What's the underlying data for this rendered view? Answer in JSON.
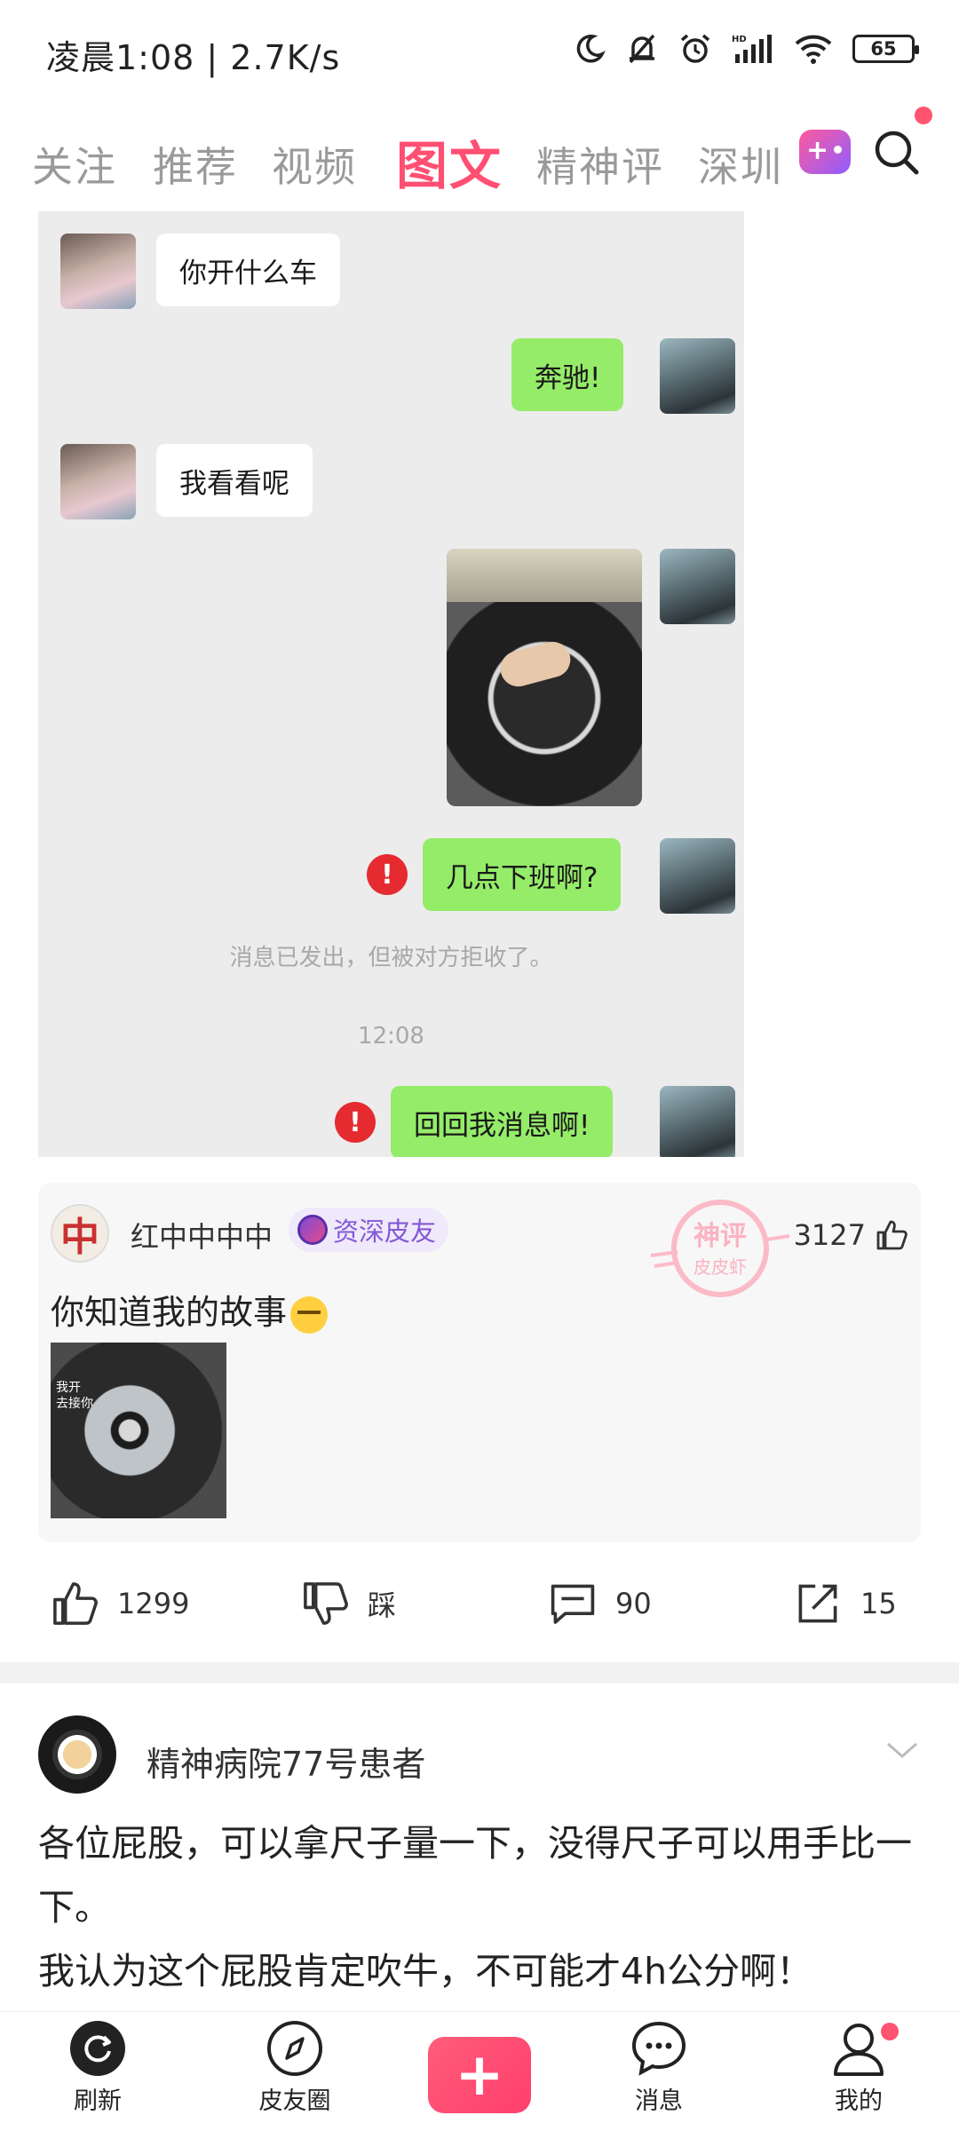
{
  "status_bar": {
    "time": "凌晨1:08 | 2.7K/s",
    "battery": "65",
    "icons": [
      "moon-icon",
      "mute-bell-icon",
      "alarm-icon",
      "hd-signal-icon",
      "wifi-icon",
      "battery-icon"
    ]
  },
  "tabs": {
    "items": [
      "关注",
      "推荐",
      "视频",
      "图文",
      "精神评",
      "深圳"
    ],
    "active": "图文",
    "game_icon": "game-icon",
    "search_icon": "search-icon"
  },
  "chat": {
    "messages": [
      {
        "side": "left",
        "text": "你开什么车"
      },
      {
        "side": "right",
        "text": "奔驰!"
      },
      {
        "side": "left",
        "text": "我看看呢"
      },
      {
        "side": "right",
        "type": "image",
        "text": ""
      },
      {
        "side": "right",
        "text": "几点下班啊?",
        "failed": true
      },
      {
        "side": "right",
        "text": "回回我消息啊!",
        "failed": true
      }
    ],
    "system_notice": "消息已发出，但被对方拒收了。",
    "timestamp": "12:08",
    "error_mark": "!"
  },
  "comment": {
    "avatar_char": "中",
    "username": "红中中中中",
    "badge": "资深皮友",
    "likes": "3127",
    "text": "你知道我的故事",
    "thumb_text_1": "我开",
    "thumb_text_2": "去接你",
    "watermark_1": "神评",
    "watermark_2": "皮皮虾"
  },
  "actions": {
    "like_count": "1299",
    "dislike_label": "踩",
    "comment_count": "90",
    "share_count": "15"
  },
  "next_post": {
    "username": "精神病院77号患者",
    "text_line1": "各位屁股，可以拿尺子量一下，没得尺子可以用手比一下。",
    "text_line2": "我认为这个屁股肯定吹牛，不可能才4h公分啊！"
  },
  "bottom_nav": {
    "refresh": "刷新",
    "circle": "皮友圈",
    "publish": "+",
    "messages": "消息",
    "me": "我的"
  },
  "colors": {
    "accent": "#ff4f73",
    "bubble_green": "#95ec69",
    "error_red": "#e52a30",
    "badge_purple": "#8458d8"
  }
}
